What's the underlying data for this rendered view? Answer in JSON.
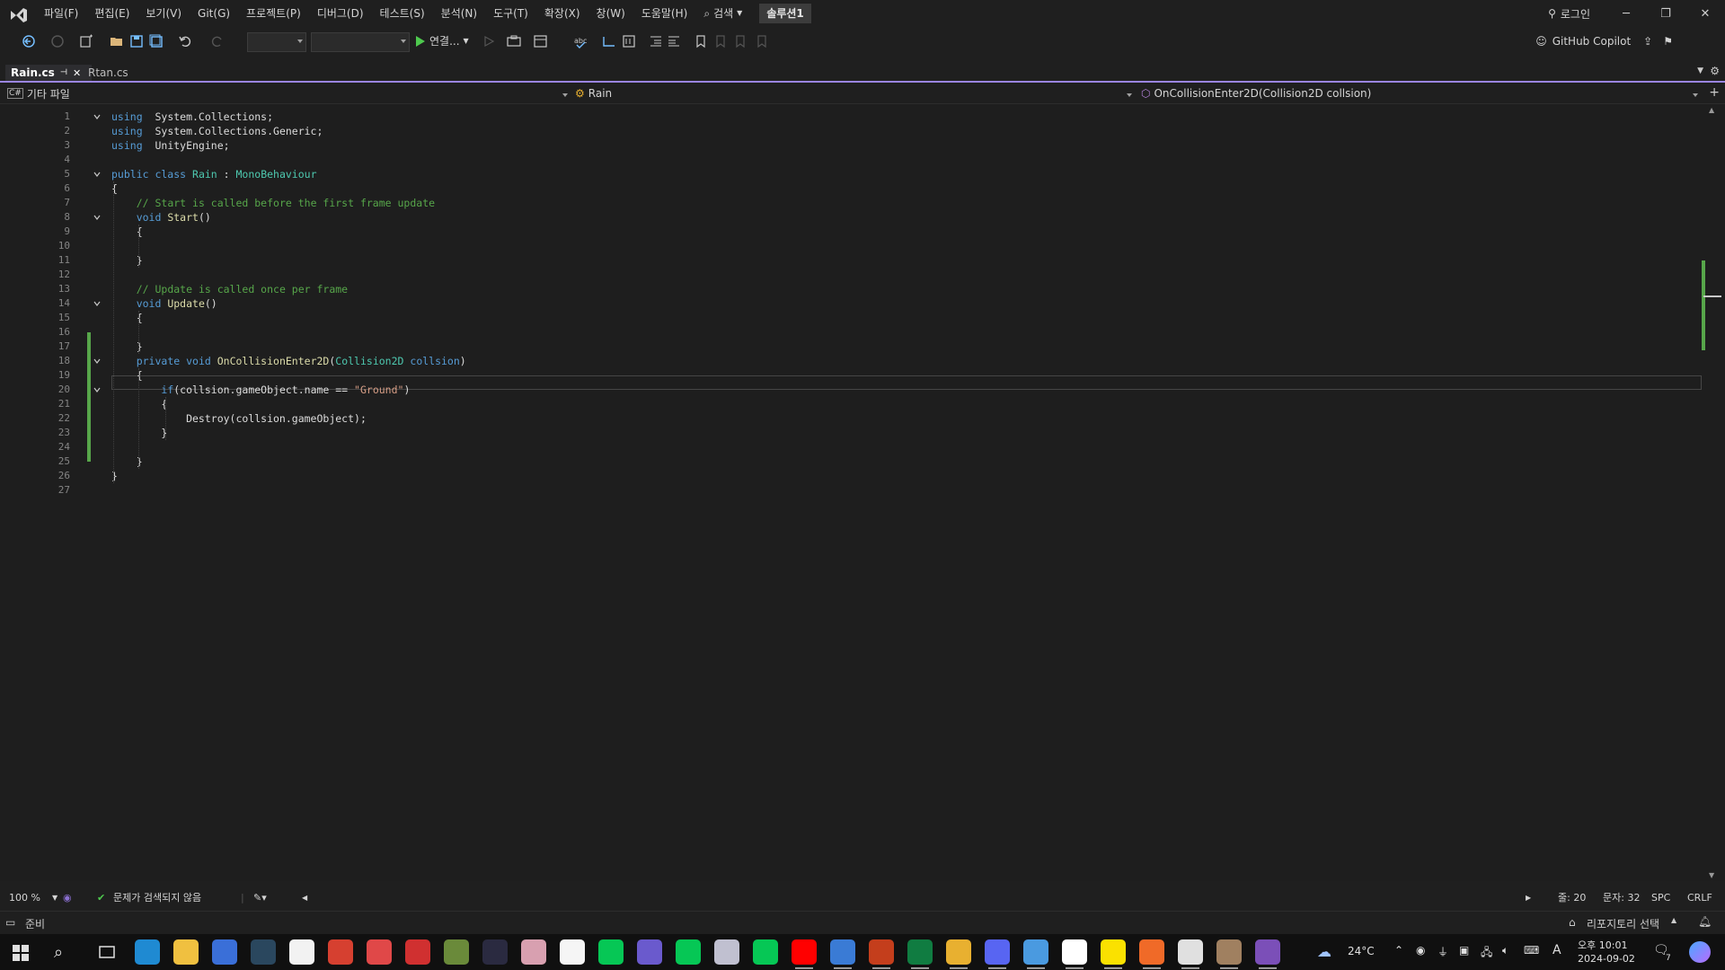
{
  "menu": {
    "items": [
      "파일(F)",
      "편집(E)",
      "보기(V)",
      "Git(G)",
      "프로젝트(P)",
      "디버그(D)",
      "테스트(S)",
      "분석(N)",
      "도구(T)",
      "확장(X)",
      "창(W)",
      "도움말(H)"
    ],
    "search_label": "검색",
    "solution_name": "솔루션1",
    "login_label": "로그인"
  },
  "toolbar": {
    "run_label": "연결...",
    "copilot_label": "GitHub Copilot"
  },
  "tabs": [
    {
      "label": "Rain.cs",
      "active": true
    },
    {
      "label": "Rtan.cs",
      "active": false
    }
  ],
  "navbar": {
    "project": "기타 파일",
    "type": "Rain",
    "member": "OnCollisionEnter2D(Collision2D collsion)"
  },
  "editor": {
    "line_numbers": [
      "1",
      "2",
      "3",
      "4",
      "5",
      "6",
      "7",
      "8",
      "9",
      "10",
      "11",
      "12",
      "13",
      "14",
      "15",
      "16",
      "17",
      "18",
      "19",
      "20",
      "21",
      "22",
      "23",
      "24",
      "25",
      "26",
      "27"
    ],
    "lines": [
      [
        [
          "kw",
          "using"
        ],
        [
          "",
          "  System.Collections;"
        ]
      ],
      [
        [
          "kw",
          "using"
        ],
        [
          "",
          "  System.Collections.Generic;"
        ]
      ],
      [
        [
          "kw",
          "using"
        ],
        [
          "",
          "  UnityEngine;"
        ]
      ],
      [],
      [
        [
          "kw",
          "public class "
        ],
        [
          "ty",
          "Rain"
        ],
        [
          "",
          " : "
        ],
        [
          "ty",
          "MonoBehaviour"
        ]
      ],
      [
        [
          "",
          "{"
        ]
      ],
      [
        [
          "",
          "    "
        ],
        [
          "cm",
          "// Start is called before the first frame update"
        ]
      ],
      [
        [
          "",
          "    "
        ],
        [
          "kw",
          "void "
        ],
        [
          "mt",
          "Start"
        ],
        [
          "",
          "()"
        ]
      ],
      [
        [
          "",
          "    {"
        ]
      ],
      [],
      [
        [
          "",
          "    }"
        ]
      ],
      [],
      [
        [
          "",
          "    "
        ],
        [
          "cm",
          "// Update is called once per frame"
        ]
      ],
      [
        [
          "",
          "    "
        ],
        [
          "kw",
          "void "
        ],
        [
          "mt",
          "Update"
        ],
        [
          "",
          "()"
        ]
      ],
      [
        [
          "",
          "    {"
        ]
      ],
      [],
      [
        [
          "",
          "    }"
        ]
      ],
      [
        [
          "",
          "    "
        ],
        [
          "kw",
          "private void "
        ],
        [
          "mt",
          "OnCollisionEnter2D"
        ],
        [
          "",
          "("
        ],
        [
          "ty",
          "Collision2D"
        ],
        [
          "",
          " "
        ],
        [
          "kw",
          "collsion"
        ],
        [
          "",
          ")"
        ]
      ],
      [
        [
          "",
          "    {"
        ]
      ],
      [
        [
          "",
          "        "
        ],
        [
          "kw",
          "if"
        ],
        [
          "",
          "(collsion.gameObject.name == "
        ],
        [
          "str",
          "\"Ground\""
        ],
        [
          "",
          ")"
        ]
      ],
      [
        [
          "",
          "        {"
        ]
      ],
      [
        [
          "",
          "            Destroy(collsion.gameObject);"
        ]
      ],
      [
        [
          "",
          "        }"
        ]
      ],
      [],
      [
        [
          "",
          "    }"
        ]
      ],
      [
        [
          "",
          "}"
        ]
      ],
      []
    ],
    "fold_lines": [
      1,
      5,
      8,
      14,
      18,
      20
    ]
  },
  "editor_status": {
    "zoom": "100 %",
    "issues": "문제가 검색되지 않음",
    "line": "줄: 20",
    "col": "문자: 32",
    "whitespace": "SPC",
    "line_ending": "CRLF"
  },
  "statusbar": {
    "ready": "준비",
    "repo": "리포지토리 선택"
  },
  "taskbar": {
    "temperature": "24°C",
    "time": "오후 10:01",
    "date": "2024-09-02",
    "ime": "A",
    "notifications": "7",
    "apps": [
      {
        "name": "edge",
        "color": "#1f8ad2"
      },
      {
        "name": "file-explorer",
        "color": "#f0c040"
      },
      {
        "name": "app-blue",
        "color": "#3a6fd8"
      },
      {
        "name": "steam",
        "color": "#2a475e"
      },
      {
        "name": "notepad-green",
        "color": "#f2f2f2"
      },
      {
        "name": "app-red-circle",
        "color": "#d64030"
      },
      {
        "name": "app-red-flower",
        "color": "#e04848"
      },
      {
        "name": "app-g-red",
        "color": "#d03030"
      },
      {
        "name": "minecraft",
        "color": "#6a8a3a"
      },
      {
        "name": "app-m",
        "color": "#2a2a40"
      },
      {
        "name": "anime-app",
        "color": "#d8a0b0"
      },
      {
        "name": "app-notes",
        "color": "#f5f5f5"
      },
      {
        "name": "line-green",
        "color": "#06c755"
      },
      {
        "name": "app-purple",
        "color": "#6a5acd"
      },
      {
        "name": "line-green-2",
        "color": "#06c755"
      },
      {
        "name": "app-photo",
        "color": "#c0c0d0"
      },
      {
        "name": "line-green-3",
        "color": "#06c755"
      },
      {
        "name": "youtube",
        "color": "#ff0000"
      },
      {
        "name": "app-ms-store",
        "color": "#3a7bd5"
      },
      {
        "name": "powerpoint",
        "color": "#c43e1c"
      },
      {
        "name": "excel",
        "color": "#107c41"
      },
      {
        "name": "chrome",
        "color": "#e8b030"
      },
      {
        "name": "discord",
        "color": "#5865f2"
      },
      {
        "name": "app-blue-2",
        "color": "#4a9ae0"
      },
      {
        "name": "unity-hub",
        "color": "#ffffff"
      },
      {
        "name": "kakaotalk",
        "color": "#fae100"
      },
      {
        "name": "app-s-orange",
        "color": "#f06a28"
      },
      {
        "name": "unity",
        "color": "#e0e0e0"
      },
      {
        "name": "app-person",
        "color": "#a08060"
      },
      {
        "name": "visual-studio",
        "color": "#7b4fb8"
      }
    ]
  },
  "colors": {
    "accent": "#9a85e0",
    "change_bar": "#57a64a",
    "keyword": "#569cd6",
    "type": "#4ec9b0",
    "comment": "#57a64a",
    "string": "#d69d85"
  }
}
